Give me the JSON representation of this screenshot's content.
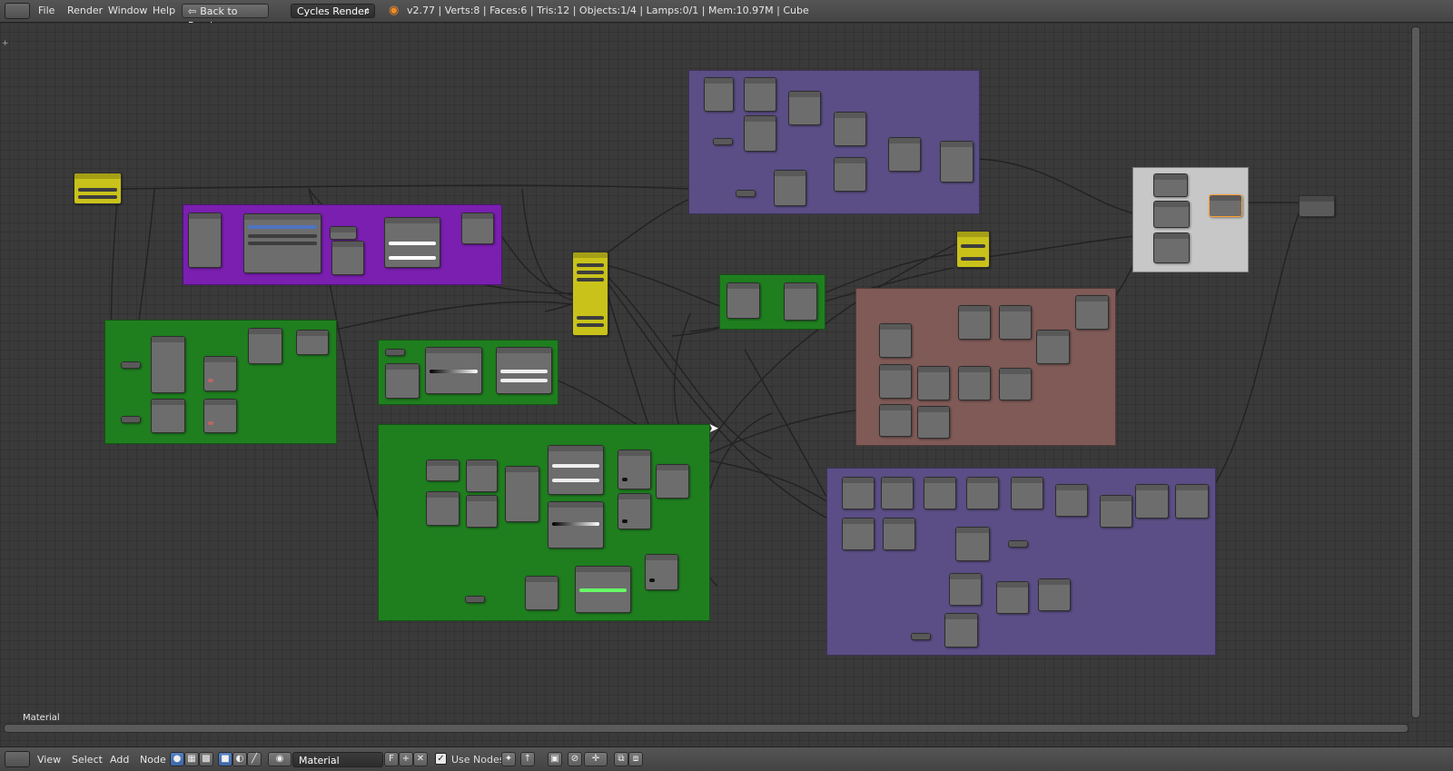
{
  "info_header": {
    "menus": [
      "File",
      "Render",
      "Window",
      "Help"
    ],
    "back_button": "Back to Previous",
    "render_engine": "Cycles Render",
    "stats": "v2.77 | Verts:8 | Faces:6 | Tris:12 | Objects:1/4 | Lamps:0/1 | Mem:10.97M | Cube"
  },
  "node_editor": {
    "label": "Material",
    "colors": {
      "purple_frame": "#5b4e86",
      "violet_frame": "#7a1fb0",
      "green_frame": "#1f7f1f",
      "red_frame": "#7f5a57",
      "gray_frame": "#c7c7c7",
      "yellow_node": "#c9c21a"
    }
  },
  "bottom_header": {
    "menus": [
      "View",
      "Select",
      "Add",
      "Node"
    ],
    "material_name": "Material",
    "fake_user": "F",
    "use_nodes_label": "Use Nodes",
    "use_nodes_checked": true
  }
}
